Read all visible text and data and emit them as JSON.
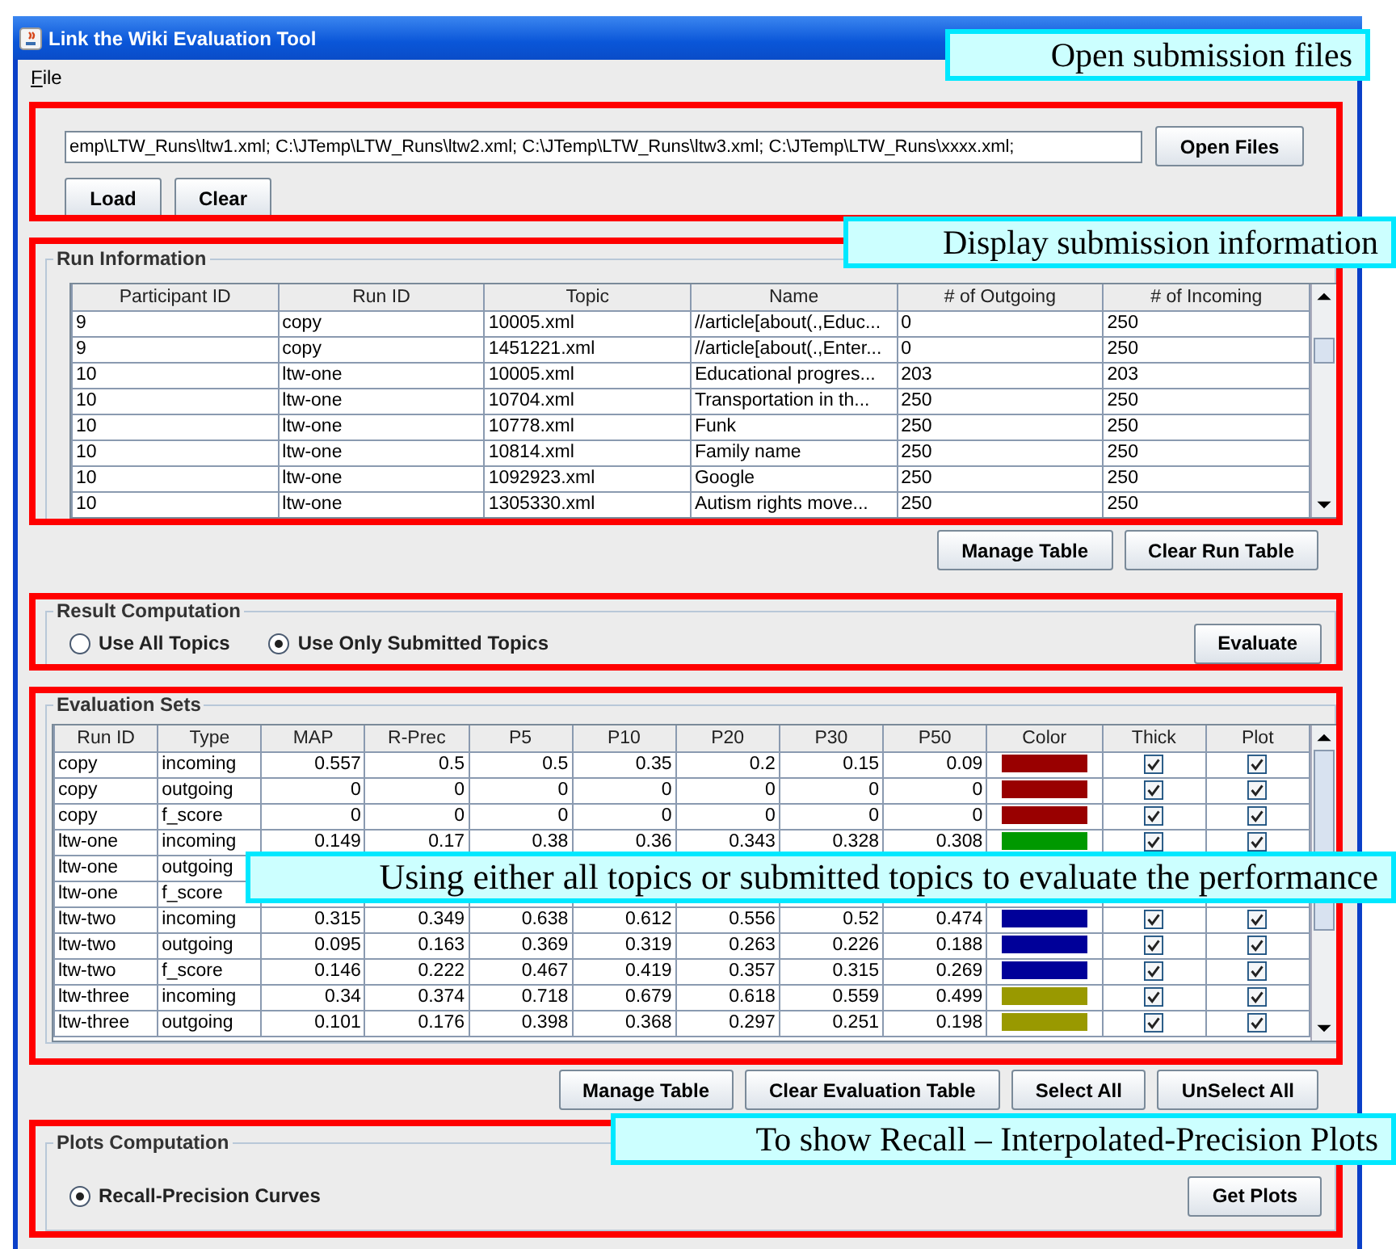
{
  "window": {
    "title": "Link the Wiki Evaluation Tool"
  },
  "menu": [
    {
      "label": "File"
    }
  ],
  "files": {
    "value": "emp\\LTW_Runs\\ltw1.xml; C:\\JTemp\\LTW_Runs\\ltw2.xml; C:\\JTemp\\LTW_Runs\\ltw3.xml; C:\\JTemp\\LTW_Runs\\xxxx.xml;",
    "open_button": "Open Files",
    "buttons": [
      "Load",
      "Clear"
    ]
  },
  "run_information": {
    "title": "Run Information",
    "columns": [
      "Participant ID",
      "Run ID",
      "Topic",
      "Name",
      "# of Outgoing",
      "# of Incoming"
    ],
    "rows": [
      [
        "9",
        "copy",
        "10005.xml",
        "//article[about(.,Educ...",
        "0",
        "250"
      ],
      [
        "9",
        "copy",
        "1451221.xml",
        "//article[about(.,Enter...",
        "0",
        "250"
      ],
      [
        "10",
        "ltw-one",
        "10005.xml",
        "Educational progres...",
        "203",
        "203"
      ],
      [
        "10",
        "ltw-one",
        "10704.xml",
        "Transportation in th...",
        "250",
        "250"
      ],
      [
        "10",
        "ltw-one",
        "10778.xml",
        "Funk",
        "250",
        "250"
      ],
      [
        "10",
        "ltw-one",
        "10814.xml",
        "Family name",
        "250",
        "250"
      ],
      [
        "10",
        "ltw-one",
        "1092923.xml",
        "Google",
        "250",
        "250"
      ],
      [
        "10",
        "ltw-one",
        "1305330.xml",
        "Autism rights move...",
        "250",
        "250"
      ]
    ],
    "buttons": [
      "Manage Table",
      "Clear Run Table"
    ]
  },
  "result_computation": {
    "title": "Result Computation",
    "options": [
      {
        "label": "Use All Topics",
        "selected": false
      },
      {
        "label": "Use Only Submitted Topics",
        "selected": true
      }
    ],
    "button": "Evaluate"
  },
  "evaluation_sets": {
    "title": "Evaluation Sets",
    "columns": [
      "Run ID",
      "Type",
      "MAP",
      "R-Prec",
      "P5",
      "P10",
      "P20",
      "P30",
      "P50",
      "Color",
      "Thick",
      "Plot"
    ],
    "rows": [
      {
        "cells": [
          "copy",
          "incoming",
          "0.557",
          "0.5",
          "0.5",
          "0.35",
          "0.2",
          "0.15",
          "0.09"
        ],
        "color": "#990000",
        "thick": true,
        "plot": true
      },
      {
        "cells": [
          "copy",
          "outgoing",
          "0",
          "0",
          "0",
          "0",
          "0",
          "0",
          "0"
        ],
        "color": "#990000",
        "thick": true,
        "plot": true
      },
      {
        "cells": [
          "copy",
          "f_score",
          "0",
          "0",
          "0",
          "0",
          "0",
          "0",
          "0"
        ],
        "color": "#990000",
        "thick": true,
        "plot": true
      },
      {
        "cells": [
          "ltw-one",
          "incoming",
          "0.149",
          "0.17",
          "0.38",
          "0.36",
          "0.343",
          "0.328",
          "0.308"
        ],
        "color": "#009900",
        "thick": true,
        "plot": true
      },
      {
        "cells": [
          "ltw-one",
          "outgoing"
        ]
      },
      {
        "cells": [
          "ltw-one",
          "f_score"
        ]
      },
      {
        "cells": [
          "ltw-two",
          "incoming",
          "0.315",
          "0.349",
          "0.638",
          "0.612",
          "0.556",
          "0.52",
          "0.474"
        ],
        "color": "#000099",
        "thick": true,
        "plot": true
      },
      {
        "cells": [
          "ltw-two",
          "outgoing",
          "0.095",
          "0.163",
          "0.369",
          "0.319",
          "0.263",
          "0.226",
          "0.188"
        ],
        "color": "#000099",
        "thick": true,
        "plot": true
      },
      {
        "cells": [
          "ltw-two",
          "f_score",
          "0.146",
          "0.222",
          "0.467",
          "0.419",
          "0.357",
          "0.315",
          "0.269"
        ],
        "color": "#000099",
        "thick": true,
        "plot": true
      },
      {
        "cells": [
          "ltw-three",
          "incoming",
          "0.34",
          "0.374",
          "0.718",
          "0.679",
          "0.618",
          "0.559",
          "0.499"
        ],
        "color": "#999900",
        "thick": true,
        "plot": true
      },
      {
        "cells": [
          "ltw-three",
          "outgoing",
          "0.101",
          "0.176",
          "0.398",
          "0.368",
          "0.297",
          "0.251",
          "0.198"
        ],
        "color": "#999900",
        "thick": true,
        "plot": true
      }
    ],
    "buttons": [
      "Manage Table",
      "Clear Evaluation Table",
      "Select All",
      "UnSelect All"
    ]
  },
  "plots_computation": {
    "title": "Plots Computation",
    "options": [
      {
        "label": "Recall-Precision Curves",
        "selected": true
      }
    ],
    "button": "Get Plots"
  },
  "annotations": [
    {
      "text": "Open submission files"
    },
    {
      "text": "Display submission information"
    },
    {
      "text": "Using either all topics or submitted topics to evaluate the performance"
    },
    {
      "text": "To show Recall – Interpolated-Precision Plots"
    }
  ]
}
